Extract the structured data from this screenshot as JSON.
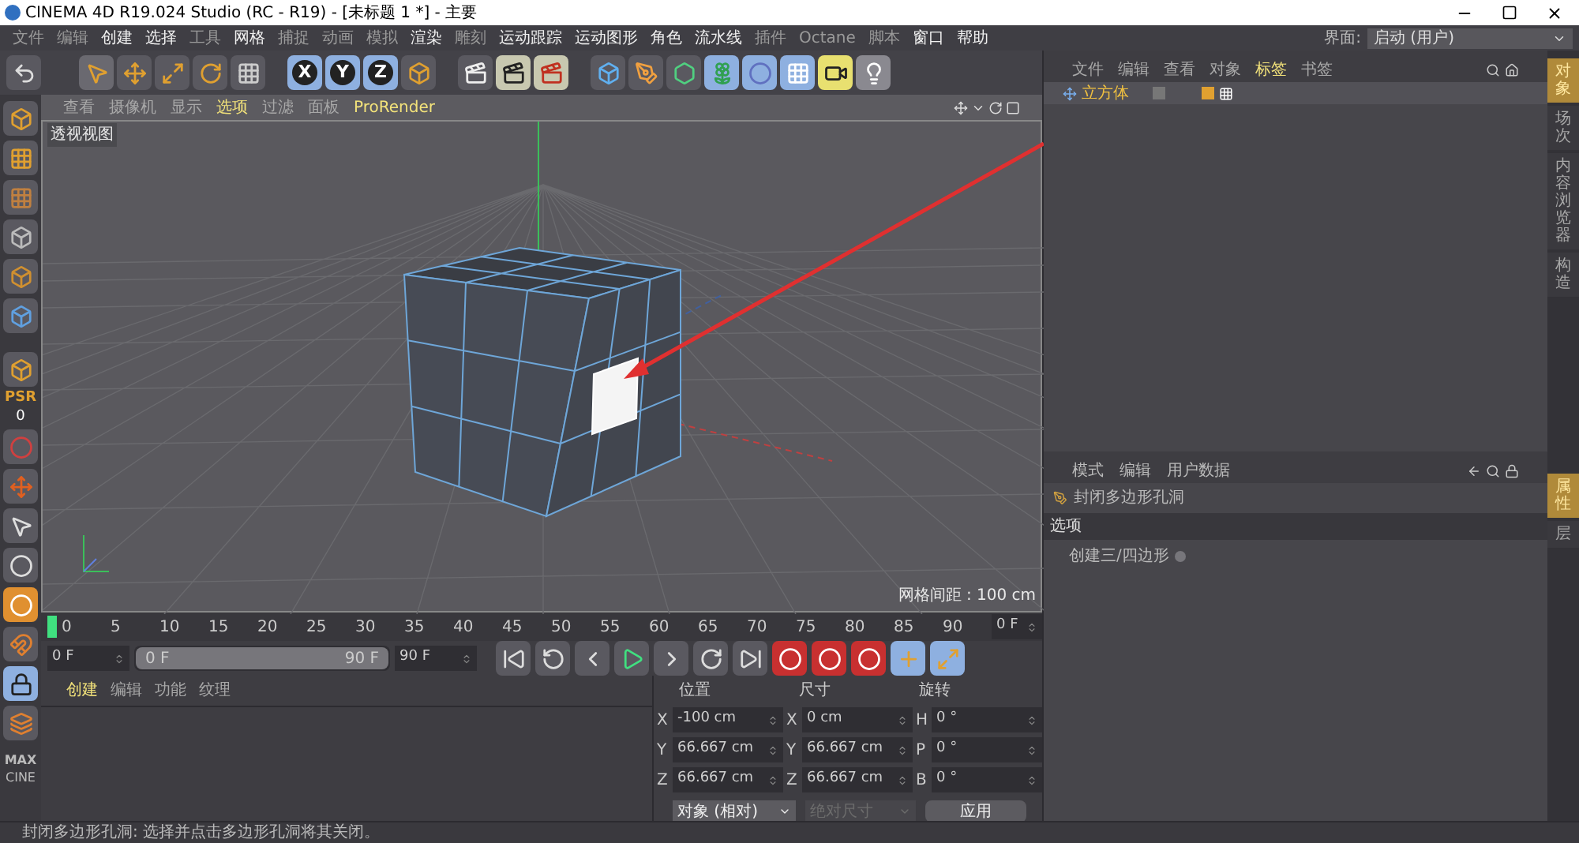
{
  "window": {
    "title": "CINEMA 4D R19.024 Studio (RC - R19) - [未标题 1 *] - 主要"
  },
  "menu_bar": [
    {
      "label": "文件",
      "bright": false
    },
    {
      "label": "编辑",
      "bright": false
    },
    {
      "label": "创建",
      "bright": true
    },
    {
      "label": "选择",
      "bright": true
    },
    {
      "label": "工具",
      "bright": false
    },
    {
      "label": "网格",
      "bright": true
    },
    {
      "label": "捕捉",
      "bright": false
    },
    {
      "label": "动画",
      "bright": false
    },
    {
      "label": "模拟",
      "bright": false
    },
    {
      "label": "渲染",
      "bright": true
    },
    {
      "label": "雕刻",
      "bright": false
    },
    {
      "label": "运动跟踪",
      "bright": true
    },
    {
      "label": "运动图形",
      "bright": true
    },
    {
      "label": "角色",
      "bright": true
    },
    {
      "label": "流水线",
      "bright": true
    },
    {
      "label": "插件",
      "bright": false
    },
    {
      "label": "Octane",
      "bright": false
    },
    {
      "label": "脚本",
      "bright": false
    },
    {
      "label": "窗口",
      "bright": true
    },
    {
      "label": "帮助",
      "bright": true
    }
  ],
  "layout": {
    "label": "界面:",
    "value": "启动 (用户)"
  },
  "toolbar": {
    "axis_buttons": [
      {
        "label": "X",
        "selected": true
      },
      {
        "label": "Y",
        "selected": true
      },
      {
        "label": "Z",
        "selected": true
      }
    ]
  },
  "left_toolbar": {
    "psr_label": "PSR",
    "psr_value": "0",
    "logo_top": "MAX",
    "logo_bottom": "CINE"
  },
  "viewport": {
    "menu": [
      {
        "label": "查看",
        "highlighted": false
      },
      {
        "label": "摄像机",
        "highlighted": false
      },
      {
        "label": "显示",
        "highlighted": false
      },
      {
        "label": "选项",
        "highlighted": true
      },
      {
        "label": "过滤",
        "highlighted": false
      },
      {
        "label": "面板",
        "highlighted": false
      },
      {
        "label": "ProRender",
        "highlighted": true
      }
    ],
    "view_name": "透视视图",
    "grid_spacing": "网格间距 : 100 cm"
  },
  "timeline": {
    "ticks": [
      "0",
      "5",
      "10",
      "15",
      "20",
      "25",
      "30",
      "35",
      "40",
      "45",
      "50",
      "55",
      "60",
      "65",
      "70",
      "75",
      "80",
      "85",
      "90"
    ],
    "level": 0,
    "frame_field": "0 F"
  },
  "playback": {
    "start": "0 F",
    "range_start": "0 F",
    "range_end": "90 F",
    "end": "90 F",
    "level": 1
  },
  "material_panel": {
    "menu": [
      {
        "label": "创建",
        "highlighted": true
      },
      {
        "label": "编辑",
        "highlighted": false
      },
      {
        "label": "功能",
        "highlighted": false
      },
      {
        "label": "纹理",
        "highlighted": false
      }
    ]
  },
  "coordinates": {
    "headings": [
      "位置",
      "尺寸",
      "旋转"
    ],
    "rows": [
      [
        {
          "axis": "X",
          "value": "-100 cm"
        },
        {
          "axis": "X",
          "value": "0 cm"
        },
        {
          "axis": "H",
          "value": "0 °"
        }
      ],
      [
        {
          "axis": "Y",
          "value": "66.667 cm"
        },
        {
          "axis": "Y",
          "value": "66.667 cm"
        },
        {
          "axis": "P",
          "value": "0 °"
        }
      ],
      [
        {
          "axis": "Z",
          "value": "66.667 cm"
        },
        {
          "axis": "Z",
          "value": "66.667 cm"
        },
        {
          "axis": "B",
          "value": "0 °"
        }
      ]
    ],
    "mode": "对象 (相对)",
    "size_mode": {
      "label": "绝对尺寸",
      "disabled": true
    },
    "apply": "应用"
  },
  "object_manager": {
    "menu": [
      {
        "label": "文件",
        "highlighted": false
      },
      {
        "label": "编辑",
        "highlighted": false
      },
      {
        "label": "查看",
        "highlighted": false
      },
      {
        "label": "对象",
        "highlighted": false
      },
      {
        "label": "标签",
        "highlighted": true
      },
      {
        "label": "书签",
        "highlighted": false
      }
    ],
    "objects": [
      {
        "name": "立方体",
        "selected": true
      }
    ]
  },
  "attributes": {
    "menu": [
      "模式",
      "编辑",
      "用户数据"
    ],
    "tool_name": "封闭多边形孔洞",
    "section": "选项",
    "options": [
      {
        "label": "创建三/四边形",
        "checked": false
      }
    ]
  },
  "side_tabs_top": [
    {
      "label": "对象",
      "selected": true
    },
    {
      "label": "场次",
      "selected": false
    },
    {
      "label": "内容浏览器",
      "selected": false
    },
    {
      "label": "构造",
      "selected": false
    }
  ],
  "side_tabs_bottom": [
    {
      "label": "属性",
      "selected": true
    },
    {
      "label": "层",
      "selected": false
    }
  ],
  "status_bar": "封闭多边形孔洞: 选择并点击多边形孔洞将其关闭。"
}
